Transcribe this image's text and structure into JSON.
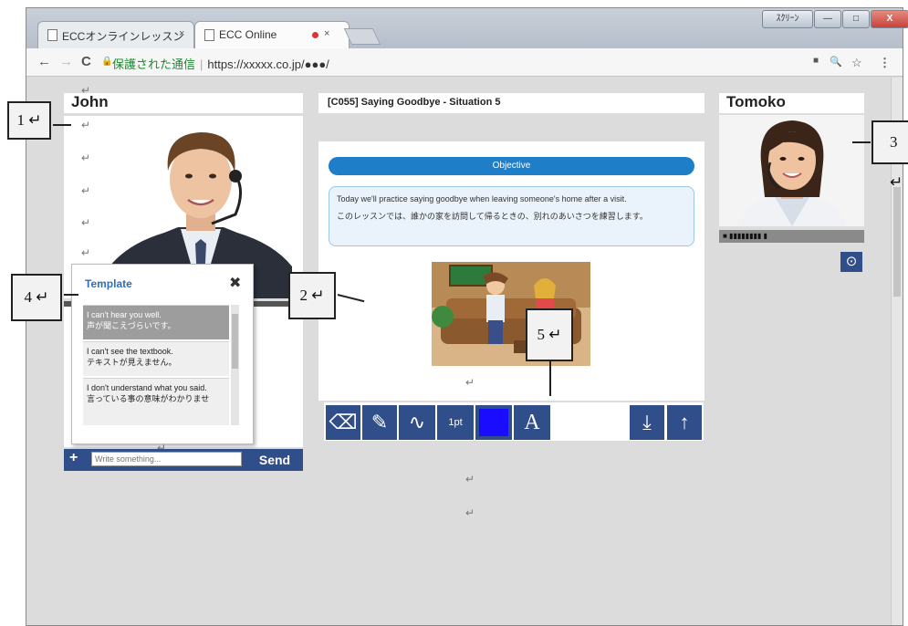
{
  "browser": {
    "tabs": [
      {
        "label": "ECCオンラインレッスン",
        "close": "×"
      },
      {
        "label": "ECC Online",
        "close": "×"
      }
    ],
    "window_buttons": [
      "ｽｸﾘｰﾝ",
      "—",
      "□",
      "X"
    ],
    "nav": {
      "back": "←",
      "forward": "→",
      "reload": "C",
      "lock": "🔒"
    },
    "address": {
      "secure_label": "保護された通信",
      "separator": "|",
      "url": "https://xxxxx.co.jp/●●●/"
    },
    "icons": {
      "camera": "■",
      "zoom": "🔍",
      "star": "☆",
      "menu": "⋮"
    }
  },
  "left": {
    "name": "John",
    "return_marks": [
      "↵",
      "↵",
      "↵",
      "↵",
      "↵",
      "↵",
      "↵"
    ],
    "chat_input": {
      "placeholder": "Write something...",
      "add": "+",
      "send": "Send"
    }
  },
  "template": {
    "title": "Template",
    "close": "✖",
    "items": [
      {
        "en": "I can't hear you well.",
        "ja": "声が聞こえづらいです。"
      },
      {
        "en": "I can't see the textbook.",
        "ja": "テキストが見えません。"
      },
      {
        "en": "I don't understand what you said.",
        "ja": "言っている事の意味がわかりませ"
      }
    ]
  },
  "lesson": {
    "title": "[C055] Saying Goodbye - Situation 5",
    "objective_label": "Objective",
    "objective_en": "Today we'll practice saying goodbye when leaving someone's home after a visit.",
    "objective_ja": "このレッスンでは、誰かの家を訪問して帰るときの、別れのあいさつを練習します。",
    "return_marks": [
      "↵",
      "↵",
      "↵"
    ]
  },
  "tools": {
    "eraser": "⌫",
    "pen": "✎",
    "curve": "∿",
    "stroke": "1pt",
    "color": "#1a0dff",
    "text": "A",
    "download": "⤓",
    "upload": "↑"
  },
  "right": {
    "name": "Tomoko",
    "volume": "■ ▮▮▮▮▮▮▮▮   ▮",
    "camera": "⊙"
  },
  "callouts": [
    {
      "label": "1 ↵"
    },
    {
      "label": "2 ↵"
    },
    {
      "label": "3 ↵"
    },
    {
      "label": "4 ↵"
    },
    {
      "label": "5 ↵"
    }
  ],
  "colors": {
    "accent": "#1f7ec8",
    "tool_bg": "#2f4e8a",
    "send_bg": "#2f4e8a"
  }
}
